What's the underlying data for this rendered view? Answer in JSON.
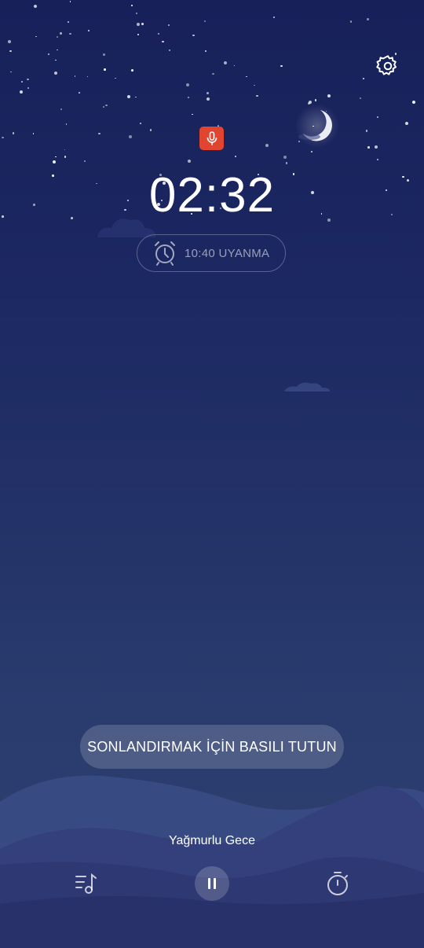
{
  "header": {
    "settings_icon": "gear-icon",
    "recording_icon": "microphone-icon",
    "recording_color": "#e2452f"
  },
  "clock": {
    "time": "02:32"
  },
  "alarm": {
    "icon": "alarm-clock-icon",
    "label": "10:40 UYANMA"
  },
  "end_prompt": {
    "label": "SONLANDIRMAK İÇİN BASILI TUTUN"
  },
  "player": {
    "track_title": "Yağmurlu Gece",
    "playlist_icon": "playlist-music-icon",
    "pause_icon": "pause-icon",
    "timer_icon": "stopwatch-icon"
  }
}
